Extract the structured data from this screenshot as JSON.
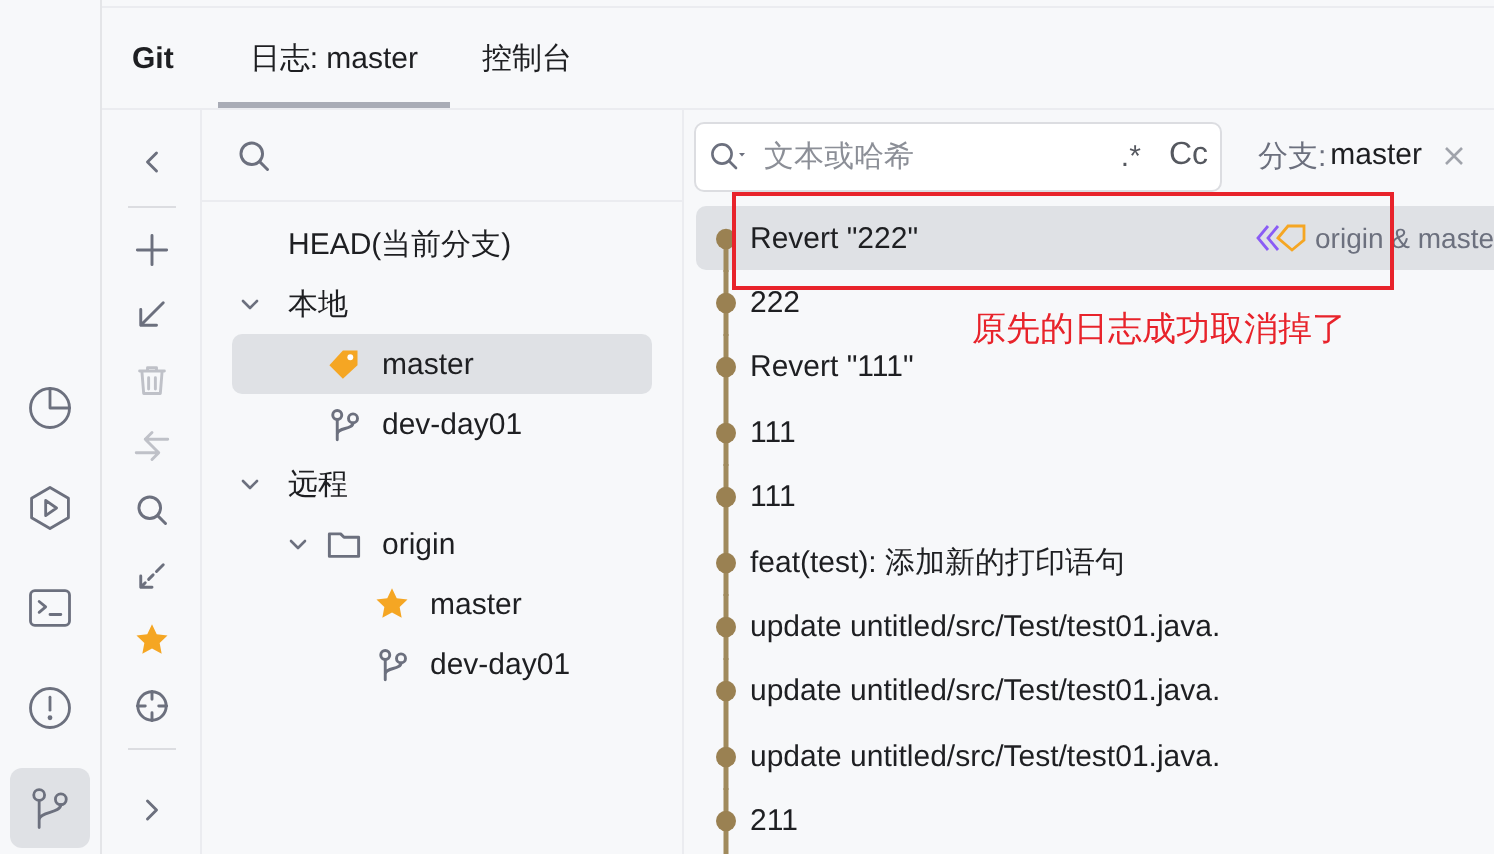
{
  "activity_bar": [
    {
      "kind": "chart",
      "selected": false
    },
    {
      "kind": "run",
      "selected": false
    },
    {
      "kind": "terminal",
      "selected": false
    },
    {
      "kind": "problems",
      "selected": false
    },
    {
      "kind": "git",
      "selected": true
    }
  ],
  "tool_window": {
    "title": "Git",
    "tabs": [
      {
        "label": "日志: master",
        "selected": true
      },
      {
        "label": "控制台",
        "selected": false
      }
    ]
  },
  "toolbar": {
    "groups": [
      [
        {
          "kind": "collapse",
          "disabled": false
        }
      ],
      [
        {
          "kind": "add",
          "disabled": false
        },
        {
          "kind": "checkout",
          "disabled": false
        },
        {
          "kind": "delete",
          "disabled": true
        },
        {
          "kind": "compare",
          "disabled": true
        },
        {
          "kind": "search",
          "disabled": false
        },
        {
          "kind": "fetch",
          "disabled": false
        },
        {
          "kind": "favorite",
          "disabled": false
        },
        {
          "kind": "locate",
          "disabled": false
        }
      ],
      [
        {
          "kind": "expand",
          "disabled": false
        }
      ]
    ]
  },
  "branches": {
    "items": [
      {
        "label": "HEAD(当前分支)",
        "selected": false
      },
      {
        "label": "本地",
        "expanded": true,
        "selected": false,
        "children": [
          {
            "label": "master",
            "kind": "tag",
            "selected": true
          },
          {
            "label": "dev-day01",
            "kind": "branch",
            "selected": false
          }
        ]
      },
      {
        "label": "远程",
        "expanded": true,
        "selected": false,
        "children": [
          {
            "label": "origin",
            "kind": "folder",
            "expanded": true,
            "selected": false,
            "children": [
              {
                "label": "master",
                "kind": "star",
                "selected": false
              },
              {
                "label": "dev-day01",
                "kind": "branch",
                "selected": false
              }
            ]
          }
        ]
      }
    ]
  },
  "log": {
    "search": {
      "placeholder": "文本或哈希",
      "regex": ".*",
      "match_case": "Cc"
    },
    "branch_filter": {
      "label": "分支:",
      "value": "master"
    },
    "commits": [
      {
        "message": "Revert \"222\"",
        "selected": true,
        "refs": "origin & maste"
      },
      {
        "message": "222",
        "selected": false
      },
      {
        "message": "Revert \"111\"",
        "selected": false
      },
      {
        "message": "111",
        "selected": false
      },
      {
        "message": "111",
        "selected": false
      },
      {
        "message": "feat(test): 添加新的打印语句",
        "selected": false
      },
      {
        "message": "update untitled/src/Test/test01.java.",
        "selected": false
      },
      {
        "message": "update untitled/src/Test/test01.java.",
        "selected": false
      },
      {
        "message": "update untitled/src/Test/test01.java.",
        "selected": false
      },
      {
        "message": "211",
        "selected": false
      }
    ],
    "annotation": {
      "text": "原先的日志成功取消掉了"
    }
  }
}
